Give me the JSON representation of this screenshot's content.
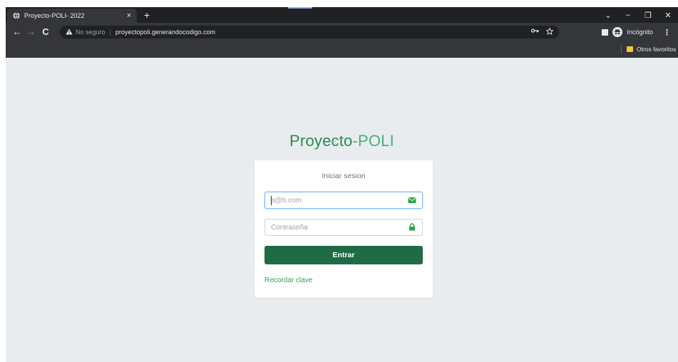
{
  "browser": {
    "tab": {
      "title": "Proyecto-POLI- 2022",
      "close": "×"
    },
    "new_tab": "+",
    "window_controls": {
      "dropdown": "⌄",
      "minimize": "–",
      "restore": "❐",
      "close": "✕"
    },
    "nav": {
      "back": "←",
      "forward": "→",
      "reload": "C"
    },
    "address": {
      "security_label": "No seguro",
      "separator": "|",
      "url": "proyectopoli.generandocodigo.com"
    },
    "profile": {
      "label": "Incógnito"
    },
    "menu": "⋮",
    "bookmarks": {
      "folder_label": "Otros favoritos"
    }
  },
  "page": {
    "brand": {
      "part1": "Proyecto",
      "part2": "-POLI"
    },
    "login": {
      "title": "Iniciar sesion",
      "email_placeholder": "a@b.com",
      "password_placeholder": "Contraseña",
      "submit_label": "Entrar",
      "remember_link": "Recordar clave"
    }
  },
  "colors": {
    "brand_green": "#2e9e5b",
    "button_green": "#1e6b45",
    "page_background": "#e9ecef"
  }
}
